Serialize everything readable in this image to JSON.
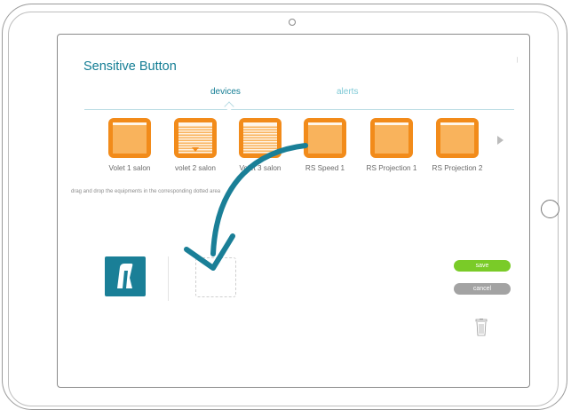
{
  "app": {
    "title": "Sensitive Button"
  },
  "tabs": [
    {
      "label": "devices",
      "active": true
    },
    {
      "label": "alerts",
      "active": false
    }
  ],
  "devices": [
    {
      "label": "Volet 1 salon",
      "icon": "shutter-open-icon"
    },
    {
      "label": "volet 2 salon",
      "icon": "shutter-closed-icon"
    },
    {
      "label": "Volet 3 salon",
      "icon": "shutter-closed-icon"
    },
    {
      "label": "RS Speed 1",
      "icon": "shutter-open-icon"
    },
    {
      "label": "RS Projection 1",
      "icon": "shutter-open-icon"
    },
    {
      "label": "RS Projection 2",
      "icon": "shutter-open-icon"
    }
  ],
  "hint": "drag and drop the equipments in the corresponding dotted area",
  "buttons": {
    "save": "save",
    "cancel": "cancel"
  },
  "colors": {
    "accent": "#137d94",
    "device_orange": "#f28b1a",
    "save_green": "#7acb28",
    "cancel_grey": "#a3a3a3",
    "drag_arrow": "#1a7f97"
  }
}
